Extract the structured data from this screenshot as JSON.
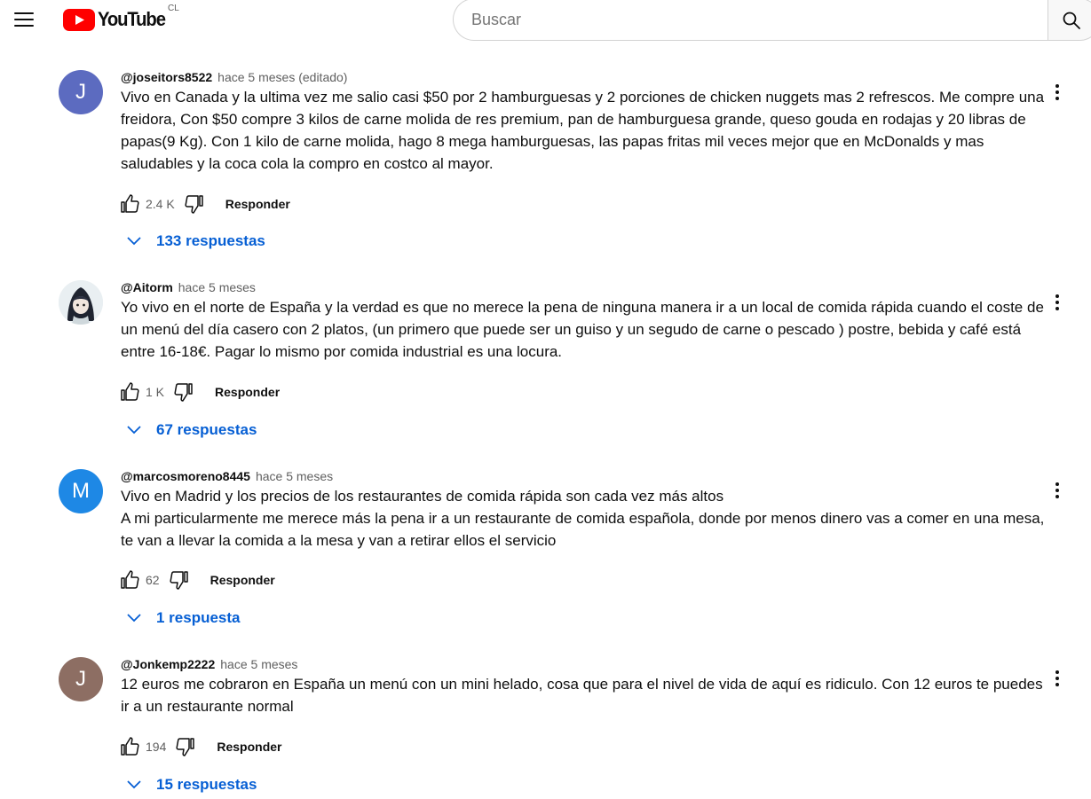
{
  "header": {
    "logo_text": "YouTube",
    "region": "CL",
    "search_placeholder": "Buscar"
  },
  "colors": {
    "link_blue": "#065fd4",
    "brand_red": "#ff0000",
    "secondary_text": "#606060"
  },
  "comments": [
    {
      "author": "@joseitors8522",
      "time": "hace 5 meses (editado)",
      "avatar_letter": "J",
      "avatar_color": "#5c6bc0",
      "text": "Vivo en Canada y la ultima vez me salio casi $50 por 2 hamburguesas y 2 porciones de chicken nuggets mas 2 refrescos. Me compre una freidora, Con $50 compre 3 kilos de carne molida de res premium, pan de hamburguesa grande, queso gouda en rodajas y 20 libras de papas(9 Kg). Con 1 kilo de carne molida, hago 8 mega hamburguesas, las papas fritas mil veces mejor que en McDonalds y mas saludables y la coca cola la compro en costco al mayor.",
      "likes": "2.4 K",
      "reply_label": "Responder",
      "replies_label": "133 respuestas"
    },
    {
      "author": "@Aitorm",
      "time": "hace 5 meses",
      "avatar_letter": "",
      "avatar_color": "#e8eef2",
      "text": "Yo vivo en el norte de España y la verdad es que no merece la pena de ninguna manera ir a un local de comida rápida cuando el coste de un menú del día casero con 2 platos, (un primero que puede ser un guiso y un segudo de carne o pescado ) postre, bebida y café está entre 16-18€. Pagar lo mismo por comida industrial es una locura.",
      "likes": "1 K",
      "reply_label": "Responder",
      "replies_label": "67 respuestas"
    },
    {
      "author": "@marcosmoreno8445",
      "time": "hace 5 meses",
      "avatar_letter": "M",
      "avatar_color": "#1e88e5",
      "text": "Vivo en Madrid y los precios de los restaurantes de comida rápida son cada vez más altos\nA mi particularmente me merece más la pena ir a un restaurante de comida española, donde por menos dinero vas a comer en una mesa, te van a llevar la comida a la mesa y van a retirar ellos el servicio",
      "likes": "62",
      "reply_label": "Responder",
      "replies_label": "1 respuesta"
    },
    {
      "author": "@Jonkemp2222",
      "time": "hace 5 meses",
      "avatar_letter": "J",
      "avatar_color": "#8d6e63",
      "text": "12 euros me cobraron en España un menú con un mini helado, cosa que para el nivel de vida de aquí es ridiculo. Con 12 euros te puedes ir a un restaurante normal",
      "likes": "194",
      "reply_label": "Responder",
      "replies_label": "15 respuestas"
    }
  ]
}
